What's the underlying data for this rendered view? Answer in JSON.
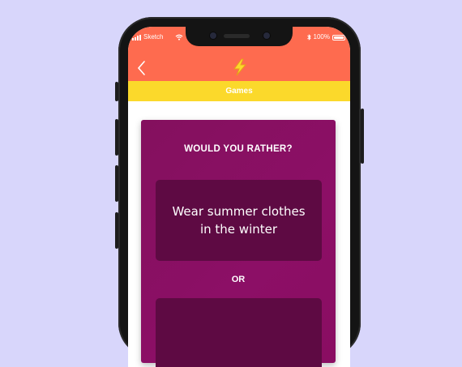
{
  "status_bar": {
    "carrier": "Sketch",
    "battery": "100%"
  },
  "header": {
    "back_icon": "chevron-left-icon",
    "logo_icon": "lightning-bolt-icon"
  },
  "tab": {
    "label": "Games"
  },
  "card": {
    "title": "WOULD YOU RATHER?",
    "option_a": "Wear summer clothes in the winter",
    "or_label": "OR",
    "option_b": ""
  },
  "colors": {
    "background": "#d8d6fb",
    "header": "#fe6b4f",
    "tab_bar": "#fbd92b",
    "card": "#8a0d62",
    "option": "#5e0a43",
    "bolt": "#fbd92b"
  }
}
